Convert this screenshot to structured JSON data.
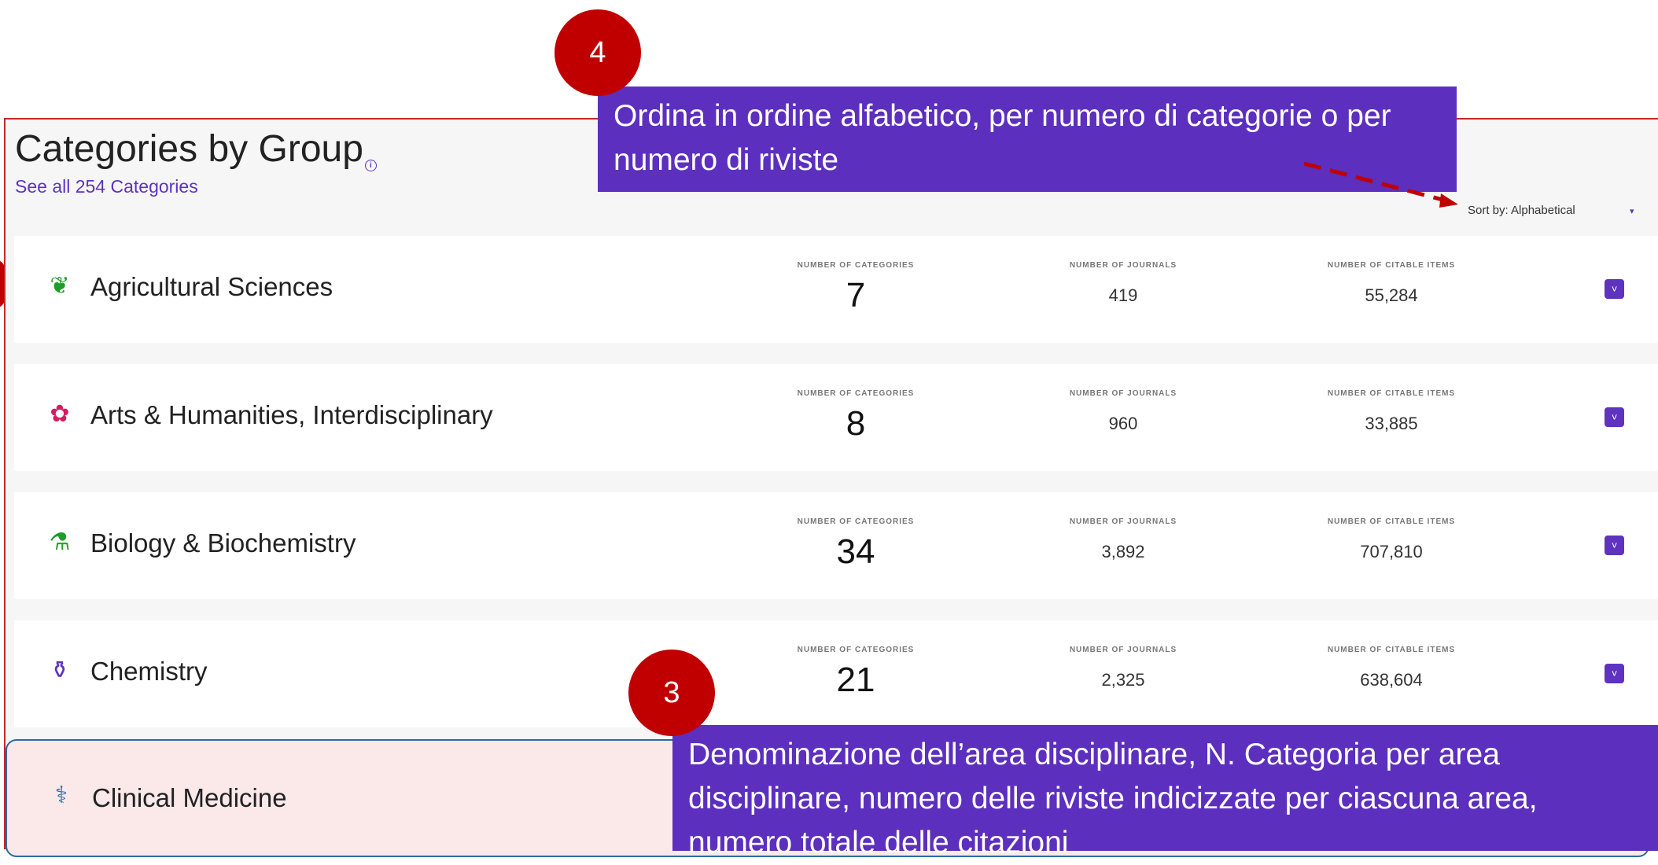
{
  "header": {
    "title": "Categories by Group",
    "info_symbol": "i",
    "see_all": "See all 254 Categories"
  },
  "sort": {
    "label": "Sort by: Alphabetical",
    "caret": "▾"
  },
  "columns": {
    "categories": "NUMBER OF CATEGORIES",
    "journals": "NUMBER OF JOURNALS",
    "citable": "NUMBER OF CITABLE ITEMS"
  },
  "rows": [
    {
      "name": "Agricultural Sciences",
      "icon": "leaf-icon",
      "glyph": "❦",
      "color": "#1f9d2a",
      "categories": "7",
      "journals": "419",
      "citable": "55,284"
    },
    {
      "name": "Arts & Humanities, Interdisciplinary",
      "icon": "palette-icon",
      "glyph": "✿",
      "color": "#d81b60",
      "categories": "8",
      "journals": "960",
      "citable": "33,885"
    },
    {
      "name": "Biology & Biochemistry",
      "icon": "microscope-icon",
      "glyph": "⚗",
      "color": "#1f9d2a",
      "categories": "34",
      "journals": "3,892",
      "citable": "707,810"
    },
    {
      "name": "Chemistry",
      "icon": "flask-icon",
      "glyph": "⚱",
      "color": "#5e33bf",
      "categories": "21",
      "journals": "2,325",
      "citable": "638,604"
    },
    {
      "name": "Clinical Medicine",
      "icon": "stethoscope-icon",
      "glyph": "⚕",
      "color": "#2b6aa3"
    }
  ],
  "expand_glyph": "˅",
  "annotations": {
    "badge4": "4",
    "callout4": "Ordina in ordine alfabetico, per numero di categorie o per numero di riviste",
    "badge3": "3",
    "callout3": "Denominazione dell’area disciplinare, N. Categoria per area disciplinare, numero delle riviste indicizzate per ciascuna area, numero totale delle citazioni"
  },
  "colors": {
    "accent": "#5e33bf",
    "annotation_red": "#c00000",
    "callout_purple": "#5c2fbf"
  }
}
